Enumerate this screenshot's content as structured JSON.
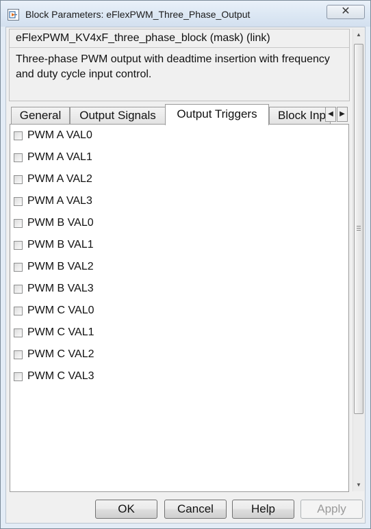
{
  "window": {
    "title": "Block Parameters: eFlexPWM_Three_Phase_Output",
    "close_glyph": "✕"
  },
  "header": {
    "block_name": "eFlexPWM_KV4xF_three_phase_block (mask) (link)",
    "description": "Three-phase PWM output with deadtime insertion with frequency and duty cycle input control."
  },
  "tabs": [
    {
      "label": "General"
    },
    {
      "label": "Output Signals"
    },
    {
      "label": "Output Triggers",
      "active": true
    },
    {
      "label": "Block Inp"
    }
  ],
  "tab_scroll": {
    "left": "◀",
    "right": "▶"
  },
  "triggers": [
    {
      "label": "PWM A VAL0",
      "checked": false
    },
    {
      "label": "PWM A VAL1",
      "checked": false
    },
    {
      "label": "PWM A VAL2",
      "checked": false
    },
    {
      "label": "PWM A VAL3",
      "checked": false
    },
    {
      "label": "PWM B VAL0",
      "checked": false
    },
    {
      "label": "PWM B VAL1",
      "checked": false
    },
    {
      "label": "PWM B VAL2",
      "checked": false
    },
    {
      "label": "PWM B VAL3",
      "checked": false
    },
    {
      "label": "PWM C VAL0",
      "checked": false
    },
    {
      "label": "PWM C VAL1",
      "checked": false
    },
    {
      "label": "PWM C VAL2",
      "checked": false
    },
    {
      "label": "PWM C VAL3",
      "checked": false
    }
  ],
  "scrollbar": {
    "up": "▲",
    "down": "▼"
  },
  "buttons": {
    "ok": "OK",
    "cancel": "Cancel",
    "help": "Help",
    "apply": "Apply"
  }
}
